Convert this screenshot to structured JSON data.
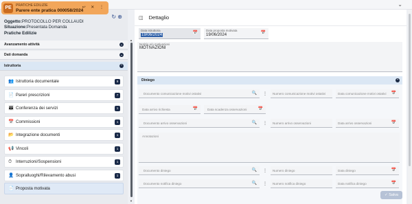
{
  "tab": {
    "logo": "PE",
    "subtitle": "PRATICHE EDILIZIE",
    "title": "Parere ente pratica 000058/2024",
    "actions": "↩ ✕ ⋮"
  },
  "info": {
    "oggetto_label": "Oggetto:",
    "oggetto_value": "PROTOCOLLO PER COLLAUDI",
    "situazione_label": "Situazione:",
    "situazione_value": "Presentata Domanda",
    "pratica_type": "Pratiche Edilizie"
  },
  "sections": {
    "avanzamento": "Avanzamento attività",
    "dati_domanda": "Dati domanda",
    "istruttoria": "Istruttoria"
  },
  "menu": [
    {
      "label": "Istruttoria documentale",
      "count": "9",
      "icon": "👥"
    },
    {
      "label": "Pareri prescrizioni",
      "count": "7",
      "icon": "📄"
    },
    {
      "label": "Conferenza dei servizi",
      "count": "1",
      "icon": "👪"
    },
    {
      "label": "Commissioni",
      "count": "1",
      "icon": "📅"
    },
    {
      "label": "Integrazione documenti",
      "count": "1",
      "icon": "📂"
    },
    {
      "label": "Vincoli",
      "count": "1",
      "icon": "📢"
    },
    {
      "label": "Interruzioni/Sospensioni",
      "count": "1",
      "icon": "⏱"
    },
    {
      "label": "Sopralluoghi/Rilevamento abusi",
      "count": "1",
      "icon": "👤"
    },
    {
      "label": "Proposta motivata",
      "count": "",
      "icon": "📄"
    }
  ],
  "main": {
    "title": "Dettaglio",
    "data_istruttoria_label": "Data istruttoria",
    "data_istruttoria_value": "19/06/2024",
    "data_proposta_label": "Data proposta motivata",
    "data_proposta_value": "19/06/2024",
    "note_label": "Notizie e/o motivazioni",
    "note_value": "MOTIVAZIONI",
    "diniego_title": "Diniego",
    "doc_comunicazione_ph": "Documento comunicazione motivi ostativi",
    "numero_comunicazione_ph": "Numero comunicazione motivi ostativi",
    "data_comunicazione_ph": "Data comunicazione motivi ostativi",
    "data_arrivo_richiesta_ph": "Data arrivo richiesta",
    "data_scadenza_ph": "Data scadenza osservazioni",
    "doc_arrivo_oss_ph": "Documento arrivo osservazioni",
    "numero_arrivo_oss_ph": "Numero arrivo osservazioni",
    "data_arrivo_oss_ph": "Data arrivo osservazioni",
    "annotazioni_ph": "Annotazioni",
    "doc_diniego_ph": "Documento diniego",
    "numero_diniego_ph": "Numero diniego",
    "data_diniego_ph": "Data diniego",
    "doc_notifica_ph": "Documento notifica diniego",
    "numero_notifica_ph": "Numero notifica diniego",
    "data_notifica_ph": "Data notifica diniego",
    "save_label": "Salva"
  },
  "colors": {
    "tab_bg": "#f2a65a",
    "badge_bg": "#1a2a48",
    "active_section": "#dbe7f4"
  }
}
